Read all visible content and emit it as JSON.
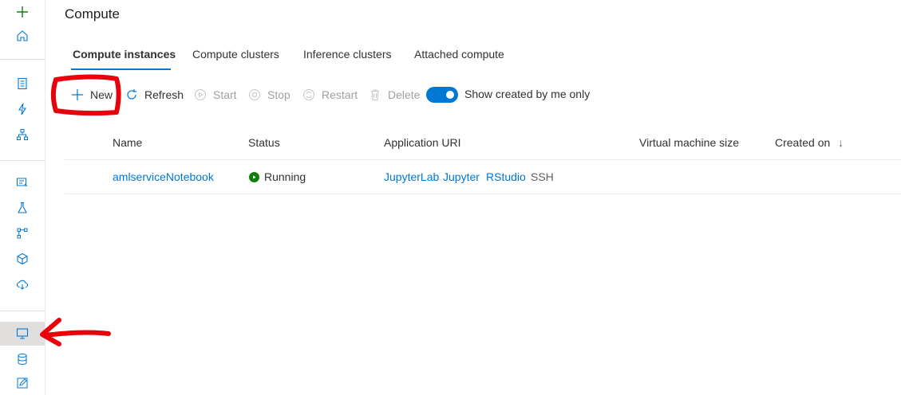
{
  "page": {
    "title": "Compute"
  },
  "tabs": [
    {
      "label": "Compute instances",
      "active": true
    },
    {
      "label": "Compute clusters",
      "active": false
    },
    {
      "label": "Inference clusters",
      "active": false
    },
    {
      "label": "Attached compute",
      "active": false
    }
  ],
  "toolbar": {
    "new_label": "New",
    "refresh_label": "Refresh",
    "start_label": "Start",
    "stop_label": "Stop",
    "restart_label": "Restart",
    "delete_label": "Delete",
    "toggle_label": "Show created by me only",
    "toggle_on": true
  },
  "table": {
    "headers": {
      "name": "Name",
      "status": "Status",
      "app_uri": "Application URI",
      "vm_size": "Virtual machine size",
      "created_on": "Created on",
      "sort_icon": "↓"
    },
    "rows": [
      {
        "name": "amlserviceNotebook",
        "status": "Running",
        "links": [
          "JupyterLab",
          "Jupyter",
          "RStudio"
        ],
        "ssh": "SSH",
        "vm_size": "",
        "created_on": ""
      }
    ]
  },
  "sidebar": {
    "icons": [
      "plus-icon",
      "home-icon",
      "notebook-icon",
      "automl-icon",
      "designer-icon",
      "datasets-icon",
      "experiments-icon",
      "pipelines-icon",
      "models-icon",
      "endpoints-icon",
      "compute-icon",
      "datastores-icon",
      "labeling-icon"
    ],
    "active": "compute-icon"
  },
  "colors": {
    "accent": "#0078d4",
    "running": "#107c10",
    "annotation": "#e8000b"
  }
}
